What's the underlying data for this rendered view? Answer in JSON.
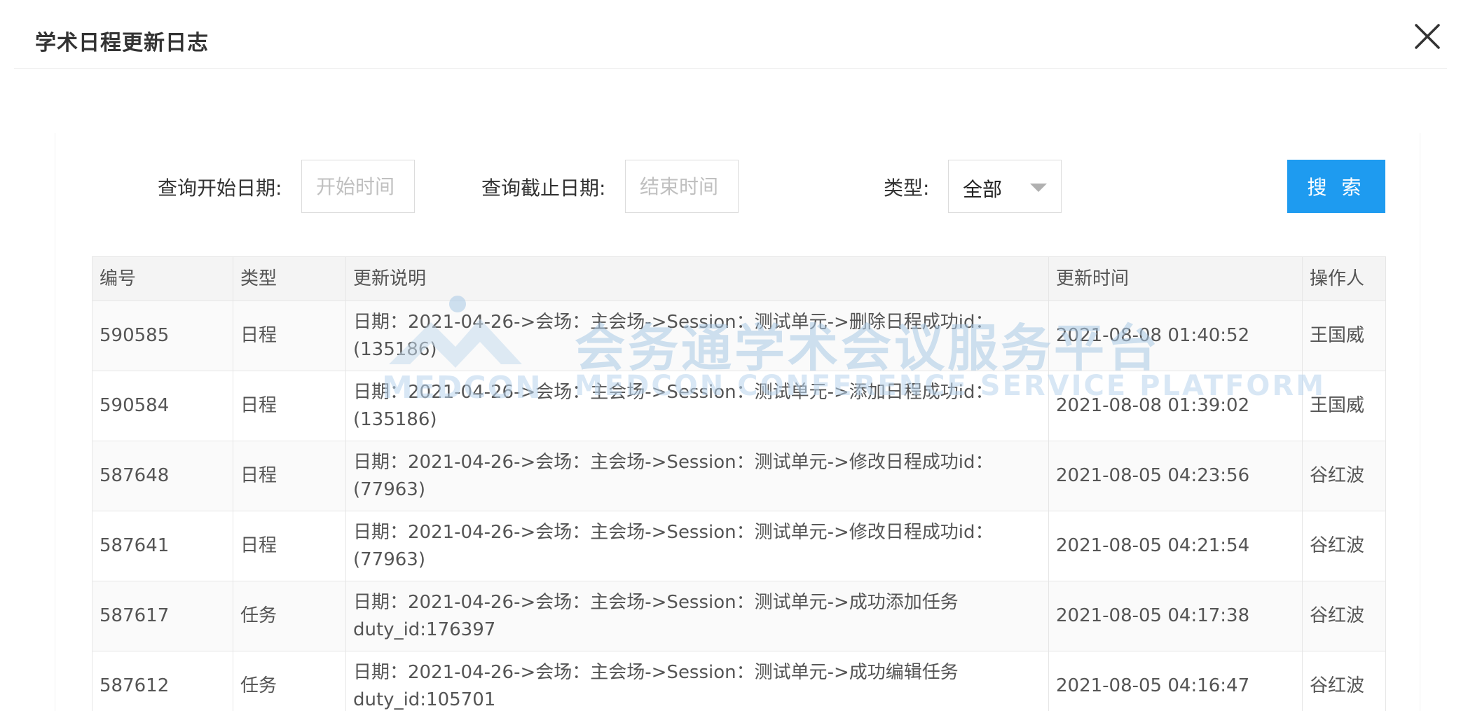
{
  "dialog": {
    "title": "学术日程更新日志",
    "close_icon": "close-icon"
  },
  "filters": {
    "start_label": "查询开始日期:",
    "start_placeholder": "开始时间",
    "start_value": "",
    "end_label": "查询截止日期:",
    "end_placeholder": "结束时间",
    "end_value": "",
    "type_label": "类型:",
    "type_value": "全部",
    "type_caret_icon": "chevron-down-icon",
    "search_label": "搜 索"
  },
  "table": {
    "columns": [
      "编号",
      "类型",
      "更新说明",
      "更新时间",
      "操作人"
    ],
    "rows": [
      {
        "id": "590585",
        "type": "日程",
        "desc": "日期：2021-04-26->会场：主会场->Session：测试单元->删除日程成功id：(135186)",
        "time": "2021-08-08 01:40:52",
        "operator": "王国威"
      },
      {
        "id": "590584",
        "type": "日程",
        "desc": "日期：2021-04-26->会场：主会场->Session：测试单元->添加日程成功id：(135186)",
        "time": "2021-08-08 01:39:02",
        "operator": "王国威"
      },
      {
        "id": "587648",
        "type": "日程",
        "desc": "日期：2021-04-26->会场：主会场->Session：测试单元->修改日程成功id：(77963)",
        "time": "2021-08-05 04:23:56",
        "operator": "谷红波"
      },
      {
        "id": "587641",
        "type": "日程",
        "desc": "日期：2021-04-26->会场：主会场->Session：测试单元->修改日程成功id：(77963)",
        "time": "2021-08-05 04:21:54",
        "operator": "谷红波"
      },
      {
        "id": "587617",
        "type": "任务",
        "desc": "日期：2021-04-26->会场：主会场->Session：测试单元->成功添加任务 duty_id:176397",
        "time": "2021-08-05 04:17:38",
        "operator": "谷红波"
      },
      {
        "id": "587612",
        "type": "任务",
        "desc": "日期：2021-04-26->会场：主会场->Session：测试单元->成功编辑任务 duty_id:105701",
        "time": "2021-08-05 04:16:47",
        "operator": "谷红波"
      }
    ]
  },
  "watermark": {
    "text_cn": "会务通学术会议服务平台",
    "text_en": "MEDCON CONFERENCE SERVICE PLATFORM",
    "brand": "MEDCON"
  },
  "colors": {
    "primary": "#1e9bf0",
    "header_bg": "#f4f4f4",
    "border": "#e6e6e6",
    "watermark": "#a9c9e6"
  }
}
